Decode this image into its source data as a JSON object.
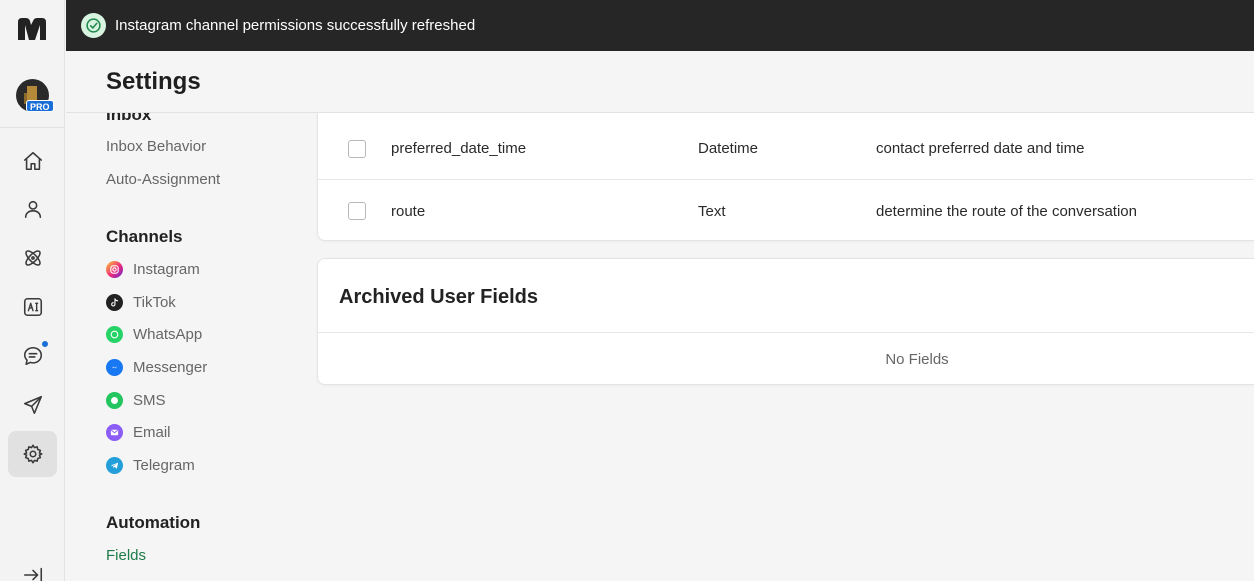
{
  "toast": {
    "message": "Instagram channel permissions successfully refreshed"
  },
  "rail": {
    "logo": "m",
    "avatar_badge": "PRO",
    "items": [
      {
        "icon": "home-icon"
      },
      {
        "icon": "user-icon"
      },
      {
        "icon": "atom-icon"
      },
      {
        "icon": "ai-icon"
      },
      {
        "icon": "chat-icon",
        "notification": true
      },
      {
        "icon": "send-icon"
      },
      {
        "icon": "gear-icon",
        "active": true
      },
      {
        "icon": "collapse-icon"
      }
    ]
  },
  "header": {
    "title": "Settings"
  },
  "nav": {
    "inbox_heading": "Inbox",
    "inbox_items": [
      "Inbox Behavior",
      "Auto-Assignment"
    ],
    "channels_heading": "Channels",
    "channels": [
      {
        "label": "Instagram",
        "color": "#e1306c"
      },
      {
        "label": "TikTok",
        "color": "#222222"
      },
      {
        "label": "WhatsApp",
        "color": "#25d366"
      },
      {
        "label": "Messenger",
        "color": "#1877f2"
      },
      {
        "label": "SMS",
        "color": "#22c55e"
      },
      {
        "label": "Email",
        "color": "#8b5cf6"
      },
      {
        "label": "Telegram",
        "color": "#229ed9"
      }
    ],
    "automation_heading": "Automation",
    "automation_items": [
      "Fields"
    ],
    "active_item": "Fields"
  },
  "fields": {
    "rows": [
      {
        "name": "preferred_date_time",
        "type": "Datetime",
        "description": "contact preferred date and time"
      },
      {
        "name": "route",
        "type": "Text",
        "description": "determine the route of the conversation"
      }
    ]
  },
  "archived": {
    "title": "Archived User Fields",
    "empty_text": "No Fields"
  },
  "colors": {
    "toast_bg": "#262626",
    "accent_green": "#1f7a4a",
    "badge_blue": "#1a6fd6"
  }
}
